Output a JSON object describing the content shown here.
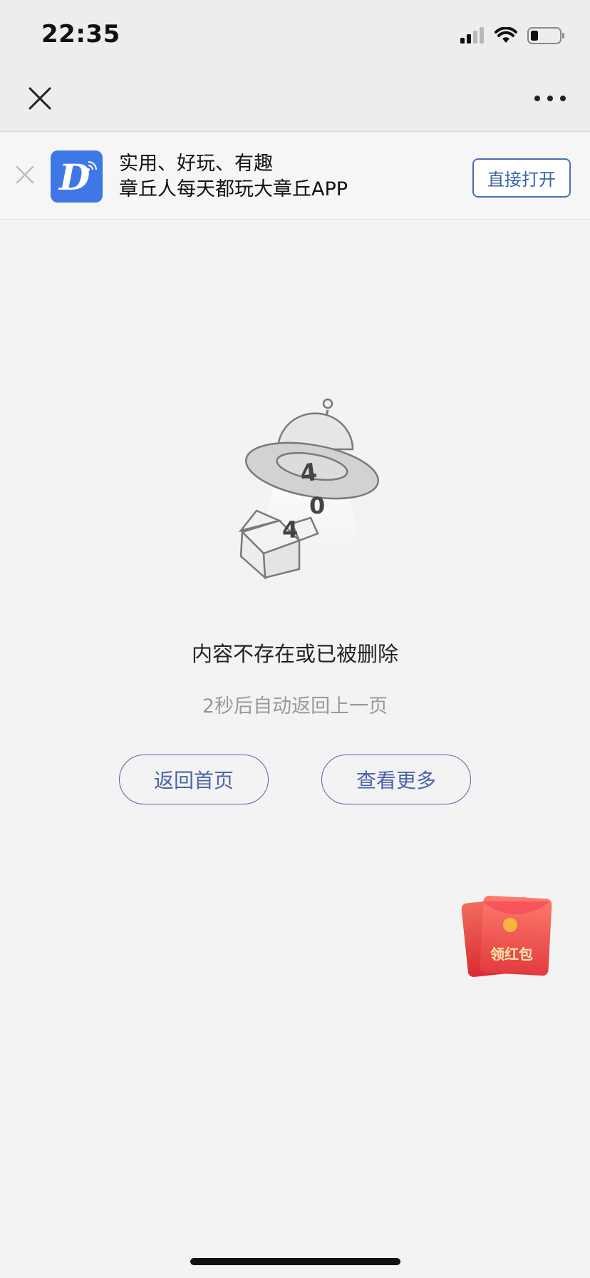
{
  "status_bar": {
    "time": "22:35"
  },
  "banner": {
    "app_logo_letter": "D",
    "line1": "实用、好玩、有趣",
    "line2": "章丘人每天都玩大章丘APP",
    "open_button": "直接打开"
  },
  "error_page": {
    "illustration_digits": [
      "4",
      "0",
      "4"
    ],
    "message": "内容不存在或已被删除",
    "countdown": "2秒后自动返回上一页",
    "home_button": "返回首页",
    "more_button": "查看更多"
  },
  "red_packet": {
    "label": "领红包"
  },
  "colors": {
    "accent": "#4b64a6",
    "logo_blue": "#3f78e6",
    "red": "#e8403f"
  }
}
